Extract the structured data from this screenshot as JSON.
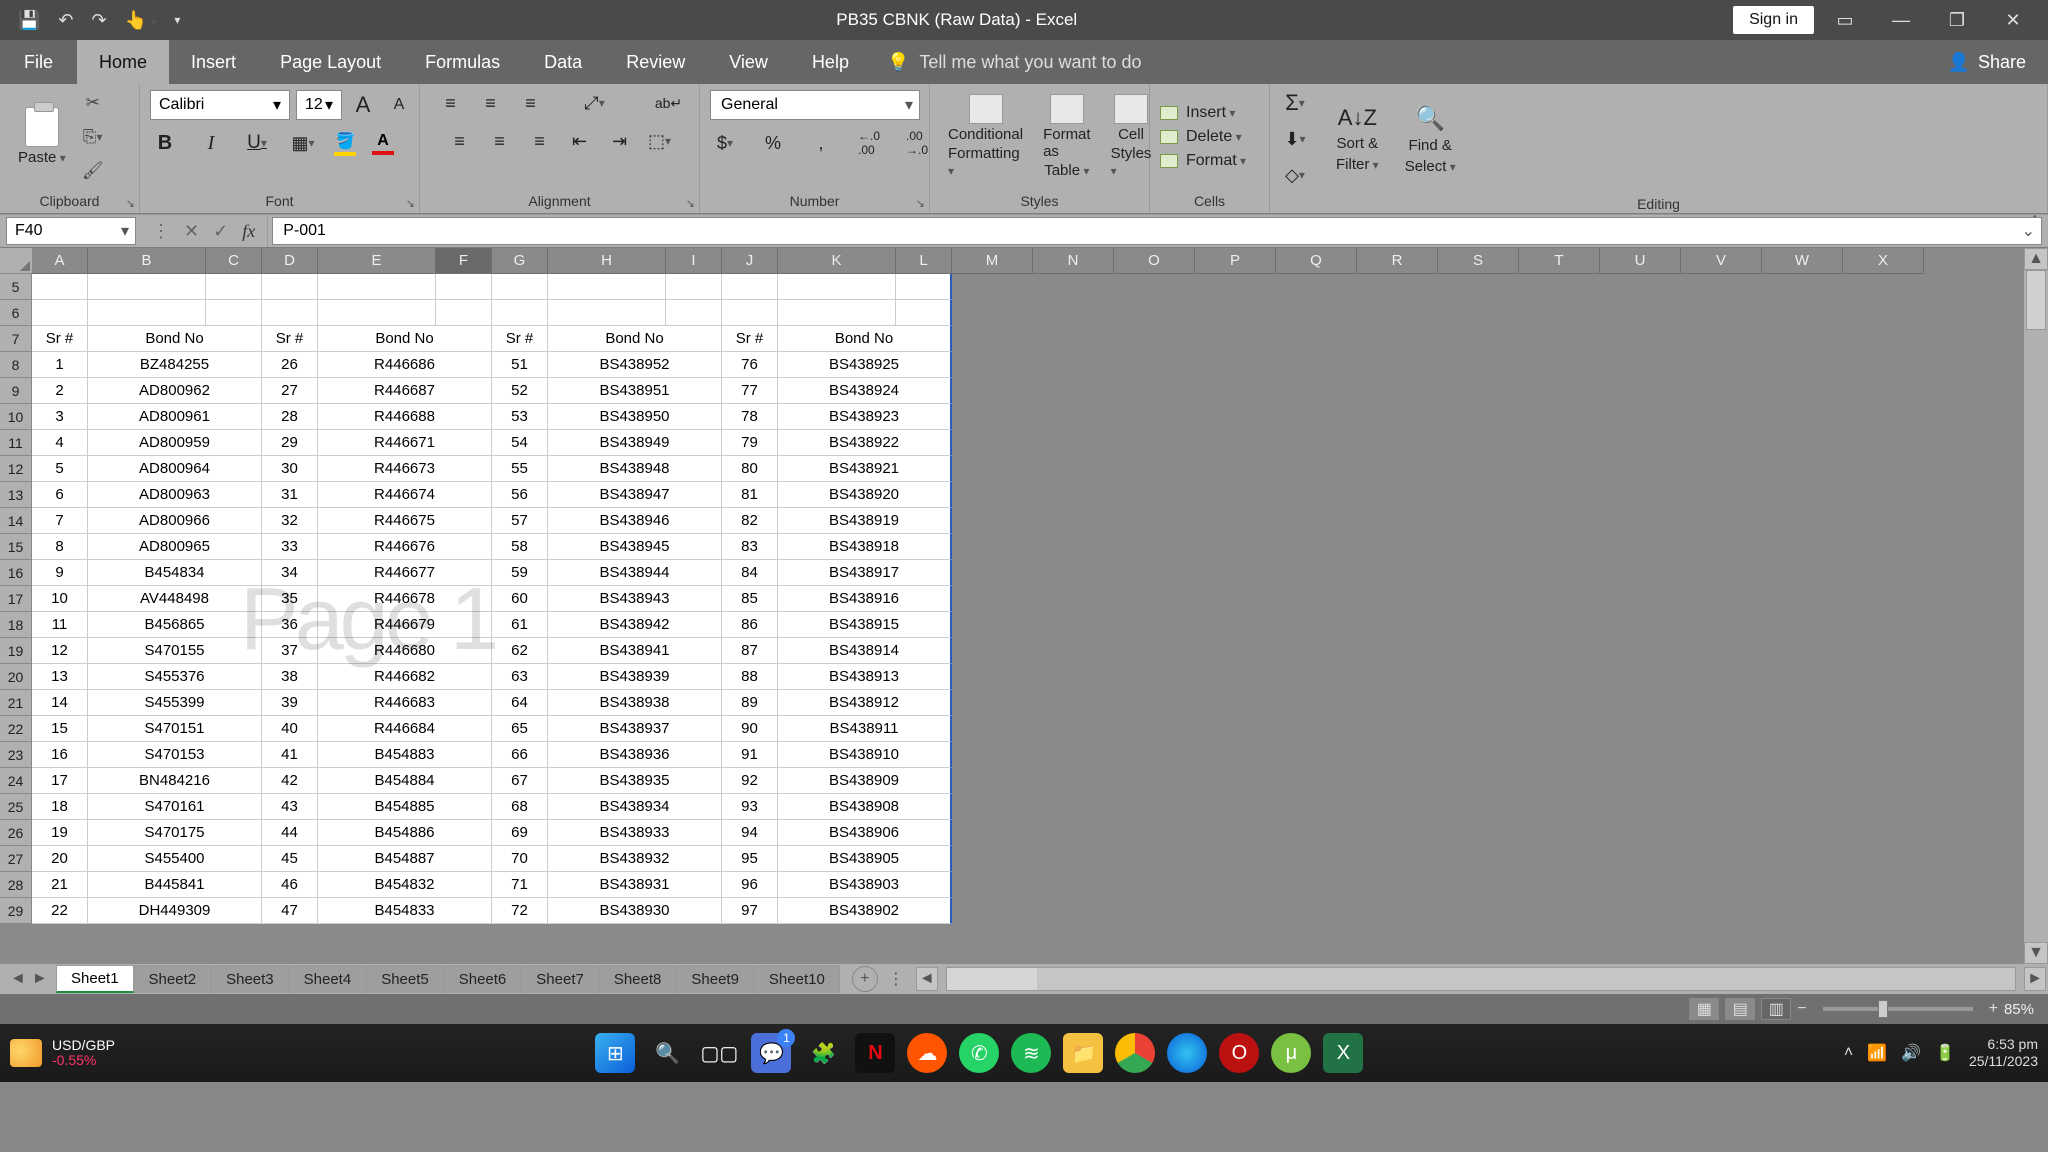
{
  "title": "PB35 CBNK (Raw Data)  -  Excel",
  "signin": "Sign in",
  "ribbon_tabs": [
    "File",
    "Home",
    "Insert",
    "Page Layout",
    "Formulas",
    "Data",
    "Review",
    "View",
    "Help"
  ],
  "tellme": "Tell me what you want to do",
  "share": "Share",
  "groups": {
    "clipboard": "Clipboard",
    "font": "Font",
    "alignment": "Alignment",
    "number": "Number",
    "styles": "Styles",
    "cells": "Cells",
    "editing": "Editing"
  },
  "paste": "Paste",
  "font_name": "Calibri",
  "font_size": "12",
  "number_format": "General",
  "styles_btns": {
    "cond": "Conditional",
    "cond2": "Formatting",
    "fmt": "Format as",
    "fmt2": "Table",
    "cell": "Cell",
    "cell2": "Styles"
  },
  "cells_btns": {
    "insert": "Insert",
    "delete": "Delete",
    "format": "Format"
  },
  "editing_btns": {
    "sort": "Sort &",
    "sort2": "Filter",
    "find": "Find &",
    "find2": "Select"
  },
  "name_box": "F40",
  "formula_value": "P-001",
  "col_headers": [
    "A",
    "B",
    "C",
    "D",
    "E",
    "F",
    "G",
    "H",
    "I",
    "J",
    "K",
    "L",
    "M",
    "N",
    "O",
    "P",
    "Q",
    "R",
    "S",
    "T",
    "U",
    "V",
    "W",
    "X"
  ],
  "active_col": "F",
  "row_start": 5,
  "table_header": {
    "sr": "Sr #",
    "bond": "Bond No"
  },
  "watermark": "Page 1",
  "rows": [
    {
      "r": 8,
      "a": "1",
      "b": "BZ484255",
      "d": "26",
      "e": "R446686",
      "g": "51",
      "h": "BS438952",
      "j": "76",
      "k": "BS438925"
    },
    {
      "r": 9,
      "a": "2",
      "b": "AD800962",
      "d": "27",
      "e": "R446687",
      "g": "52",
      "h": "BS438951",
      "j": "77",
      "k": "BS438924"
    },
    {
      "r": 10,
      "a": "3",
      "b": "AD800961",
      "d": "28",
      "e": "R446688",
      "g": "53",
      "h": "BS438950",
      "j": "78",
      "k": "BS438923"
    },
    {
      "r": 11,
      "a": "4",
      "b": "AD800959",
      "d": "29",
      "e": "R446671",
      "g": "54",
      "h": "BS438949",
      "j": "79",
      "k": "BS438922"
    },
    {
      "r": 12,
      "a": "5",
      "b": "AD800964",
      "d": "30",
      "e": "R446673",
      "g": "55",
      "h": "BS438948",
      "j": "80",
      "k": "BS438921"
    },
    {
      "r": 13,
      "a": "6",
      "b": "AD800963",
      "d": "31",
      "e": "R446674",
      "g": "56",
      "h": "BS438947",
      "j": "81",
      "k": "BS438920"
    },
    {
      "r": 14,
      "a": "7",
      "b": "AD800966",
      "d": "32",
      "e": "R446675",
      "g": "57",
      "h": "BS438946",
      "j": "82",
      "k": "BS438919"
    },
    {
      "r": 15,
      "a": "8",
      "b": "AD800965",
      "d": "33",
      "e": "R446676",
      "g": "58",
      "h": "BS438945",
      "j": "83",
      "k": "BS438918"
    },
    {
      "r": 16,
      "a": "9",
      "b": "B454834",
      "d": "34",
      "e": "R446677",
      "g": "59",
      "h": "BS438944",
      "j": "84",
      "k": "BS438917"
    },
    {
      "r": 17,
      "a": "10",
      "b": "AV448498",
      "d": "35",
      "e": "R446678",
      "g": "60",
      "h": "BS438943",
      "j": "85",
      "k": "BS438916"
    },
    {
      "r": 18,
      "a": "11",
      "b": "B456865",
      "d": "36",
      "e": "R446679",
      "g": "61",
      "h": "BS438942",
      "j": "86",
      "k": "BS438915"
    },
    {
      "r": 19,
      "a": "12",
      "b": "S470155",
      "d": "37",
      "e": "R446680",
      "g": "62",
      "h": "BS438941",
      "j": "87",
      "k": "BS438914"
    },
    {
      "r": 20,
      "a": "13",
      "b": "S455376",
      "d": "38",
      "e": "R446682",
      "g": "63",
      "h": "BS438939",
      "j": "88",
      "k": "BS438913"
    },
    {
      "r": 21,
      "a": "14",
      "b": "S455399",
      "d": "39",
      "e": "R446683",
      "g": "64",
      "h": "BS438938",
      "j": "89",
      "k": "BS438912"
    },
    {
      "r": 22,
      "a": "15",
      "b": "S470151",
      "d": "40",
      "e": "R446684",
      "g": "65",
      "h": "BS438937",
      "j": "90",
      "k": "BS438911"
    },
    {
      "r": 23,
      "a": "16",
      "b": "S470153",
      "d": "41",
      "e": "B454883",
      "g": "66",
      "h": "BS438936",
      "j": "91",
      "k": "BS438910"
    },
    {
      "r": 24,
      "a": "17",
      "b": "BN484216",
      "d": "42",
      "e": "B454884",
      "g": "67",
      "h": "BS438935",
      "j": "92",
      "k": "BS438909"
    },
    {
      "r": 25,
      "a": "18",
      "b": "S470161",
      "d": "43",
      "e": "B454885",
      "g": "68",
      "h": "BS438934",
      "j": "93",
      "k": "BS438908"
    },
    {
      "r": 26,
      "a": "19",
      "b": "S470175",
      "d": "44",
      "e": "B454886",
      "g": "69",
      "h": "BS438933",
      "j": "94",
      "k": "BS438906"
    },
    {
      "r": 27,
      "a": "20",
      "b": "S455400",
      "d": "45",
      "e": "B454887",
      "g": "70",
      "h": "BS438932",
      "j": "95",
      "k": "BS438905"
    },
    {
      "r": 28,
      "a": "21",
      "b": "B445841",
      "d": "46",
      "e": "B454832",
      "g": "71",
      "h": "BS438931",
      "j": "96",
      "k": "BS438903"
    },
    {
      "r": 29,
      "a": "22",
      "b": "DH449309",
      "d": "47",
      "e": "B454833",
      "g": "72",
      "h": "BS438930",
      "j": "97",
      "k": "BS438902"
    }
  ],
  "gray_cols_width": 81,
  "sheet_tabs": [
    "Sheet1",
    "Sheet2",
    "Sheet3",
    "Sheet4",
    "Sheet5",
    "Sheet6",
    "Sheet7",
    "Sheet8",
    "Sheet9",
    "Sheet10"
  ],
  "active_sheet": "Sheet1",
  "zoom": "85%",
  "taskbar": {
    "weather_pair": "USD/GBP",
    "weather_val": "-0.55%",
    "time": "6:53 pm",
    "date": "25/11/2023"
  }
}
